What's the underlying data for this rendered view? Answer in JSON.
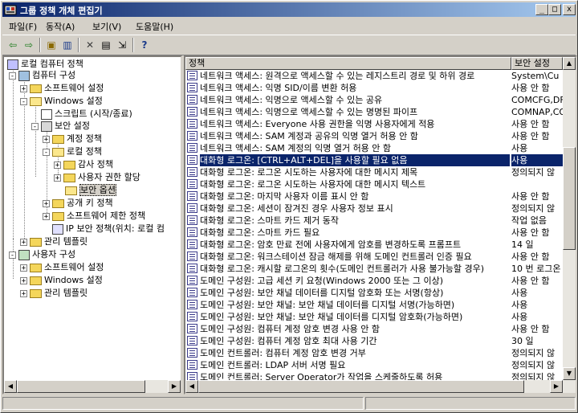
{
  "window": {
    "title": "그룹 정책 개체 편집기",
    "min_label": "_",
    "max_label": "□",
    "close_label": "x"
  },
  "menu": [
    "파일(F)",
    "동작(A)",
    "보기(V)",
    "도움말(H)"
  ],
  "toolbar": {
    "back_glyph": "⇦",
    "forward_glyph": "⇨",
    "up_glyph": "▣",
    "tree_glyph": "▥",
    "delete_glyph": "✕",
    "properties_glyph": "▤",
    "export_glyph": "⇲",
    "help_glyph": "?"
  },
  "tree": {
    "items": [
      {
        "label": "로컬 컴퓨터 정책",
        "expander": ""
      },
      {
        "label": "컴퓨터 구성",
        "expander": "-"
      },
      {
        "label": "소프트웨어 설정",
        "expander": "+"
      },
      {
        "label": "Windows 설정",
        "expander": "-"
      },
      {
        "label": "스크립트 (시작/종료)",
        "expander": ""
      },
      {
        "label": "보안 설정",
        "expander": "-"
      },
      {
        "label": "계정 정책",
        "expander": "+"
      },
      {
        "label": "로컬 정책",
        "expander": "-"
      },
      {
        "label": "감사 정책",
        "expander": "+"
      },
      {
        "label": "사용자 권한 할당",
        "expander": "+"
      },
      {
        "label": "보안 옵션",
        "expander": ""
      },
      {
        "label": "공개 키 정책",
        "expander": "+"
      },
      {
        "label": "소프트웨어 제한 정책",
        "expander": "+"
      },
      {
        "label": "IP 보안 정책(위치: 로컬 컴",
        "expander": ""
      },
      {
        "label": "관리 템플릿",
        "expander": "+"
      },
      {
        "label": "사용자 구성",
        "expander": "-"
      },
      {
        "label": "소프트웨어 설정",
        "expander": "+"
      },
      {
        "label": "Windows 설정",
        "expander": "+"
      },
      {
        "label": "관리 템플릿",
        "expander": "+"
      }
    ]
  },
  "list": {
    "columns": [
      "정책",
      "보안 설정"
    ],
    "rows": [
      {
        "policy": "네트워크 액세스: 원격으로 액세스할 수 있는 레지스트리 경로 및 하위 경로",
        "setting": "System\\Cu"
      },
      {
        "policy": "네트워크 액세스: 익명 SID/이름 변환 허용",
        "setting": "사용 안 함"
      },
      {
        "policy": "네트워크 액세스: 익명으로 액세스할 수 있는 공유",
        "setting": "COMCFG,DF"
      },
      {
        "policy": "네트워크 액세스: 익명으로 액세스할 수 있는 명명된 파이프",
        "setting": "COMNAP,CO"
      },
      {
        "policy": "네트워크 액세스: Everyone 사용 권한을 익명 사용자에게 적용",
        "setting": "사용 안 함"
      },
      {
        "policy": "네트워크 액세스: SAM 계정과 공유의 익명 열거 허용 안 함",
        "setting": "사용 안 함"
      },
      {
        "policy": "네트워크 액세스: SAM 계정의 익명 열거 허용 안 함",
        "setting": "사용"
      },
      {
        "policy": "대화형 로그온: [CTRL+ALT+DEL]을 사용할 필요 없음",
        "setting": "사용"
      },
      {
        "policy": "대화형 로그온: 로그온 시도하는 사용자에 대한 메시지 제목",
        "setting": "정의되지 않"
      },
      {
        "policy": "대화형 로그온: 로그온 시도하는 사용자에 대한 메시지 텍스트",
        "setting": ""
      },
      {
        "policy": "대화형 로그온: 마지막 사용자 이름 표시 안 함",
        "setting": "사용 안 함"
      },
      {
        "policy": "대화형 로그온: 세션이 잠겨진 경우 사용자 정보 표시",
        "setting": "정의되지 않"
      },
      {
        "policy": "대화형 로그온: 스마트 카드 제거 동작",
        "setting": "작업 없음"
      },
      {
        "policy": "대화형 로그온: 스마트 카드 필요",
        "setting": "사용 안 함"
      },
      {
        "policy": "대화형 로그온: 암호 만료 전에 사용자에게 암호를 변경하도록 프롬프트",
        "setting": "14 일"
      },
      {
        "policy": "대화형 로그온: 워크스테이션 잠금 해제를 위해 도메인 컨트롤러 인증 필요",
        "setting": "사용 안 함"
      },
      {
        "policy": "대화형 로그온: 캐시할 로그온의 횟수(도메인 컨트롤러가 사용 불가능할 경우)",
        "setting": "10 번 로그온"
      },
      {
        "policy": "도메인 구성원: 고급 세션 키 요청(Windows 2000 또는 그 이상)",
        "setting": "사용 안 함"
      },
      {
        "policy": "도메인 구성원: 보안 채널 데이터를 디지털 암호화 또는 서명(항상)",
        "setting": "사용"
      },
      {
        "policy": "도메인 구성원: 보안 채널: 보안 채널 데이터를 디지털 서명(가능하면)",
        "setting": "사용"
      },
      {
        "policy": "도메인 구성원: 보안 채널: 보안 채널 데이터를 디지털 암호화(가능하면)",
        "setting": "사용"
      },
      {
        "policy": "도메인 구성원: 컴퓨터 계정 암호 변경 사용 안 함",
        "setting": "사용 안 함"
      },
      {
        "policy": "도메인 구성원: 컴퓨터 계정 암호 최대 사용 기간",
        "setting": "30 일"
      },
      {
        "policy": "도메인 컨트롤러: 컴퓨터 계정 암호 변경 거부",
        "setting": "정의되지 않"
      },
      {
        "policy": "도메인 컨트롤러: LDAP 서버 서명 필요",
        "setting": "정의되지 않"
      },
      {
        "policy": "도메인 컨트롤러: Server Operator가 작업을 스케줄하도록 허용",
        "setting": "정의되지 않"
      }
    ],
    "selected_index": 7
  }
}
